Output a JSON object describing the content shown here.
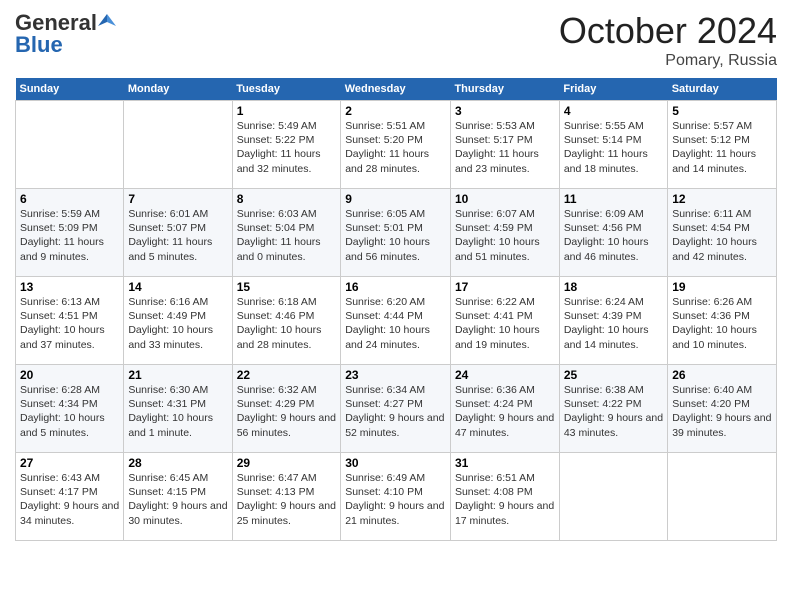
{
  "header": {
    "logo_general": "General",
    "logo_blue": "Blue",
    "month": "October 2024",
    "location": "Pomary, Russia"
  },
  "weekdays": [
    "Sunday",
    "Monday",
    "Tuesday",
    "Wednesday",
    "Thursday",
    "Friday",
    "Saturday"
  ],
  "weeks": [
    [
      {
        "day": "",
        "info": ""
      },
      {
        "day": "",
        "info": ""
      },
      {
        "day": "1",
        "info": "Sunrise: 5:49 AM\nSunset: 5:22 PM\nDaylight: 11 hours and 32 minutes."
      },
      {
        "day": "2",
        "info": "Sunrise: 5:51 AM\nSunset: 5:20 PM\nDaylight: 11 hours and 28 minutes."
      },
      {
        "day": "3",
        "info": "Sunrise: 5:53 AM\nSunset: 5:17 PM\nDaylight: 11 hours and 23 minutes."
      },
      {
        "day": "4",
        "info": "Sunrise: 5:55 AM\nSunset: 5:14 PM\nDaylight: 11 hours and 18 minutes."
      },
      {
        "day": "5",
        "info": "Sunrise: 5:57 AM\nSunset: 5:12 PM\nDaylight: 11 hours and 14 minutes."
      }
    ],
    [
      {
        "day": "6",
        "info": "Sunrise: 5:59 AM\nSunset: 5:09 PM\nDaylight: 11 hours and 9 minutes."
      },
      {
        "day": "7",
        "info": "Sunrise: 6:01 AM\nSunset: 5:07 PM\nDaylight: 11 hours and 5 minutes."
      },
      {
        "day": "8",
        "info": "Sunrise: 6:03 AM\nSunset: 5:04 PM\nDaylight: 11 hours and 0 minutes."
      },
      {
        "day": "9",
        "info": "Sunrise: 6:05 AM\nSunset: 5:01 PM\nDaylight: 10 hours and 56 minutes."
      },
      {
        "day": "10",
        "info": "Sunrise: 6:07 AM\nSunset: 4:59 PM\nDaylight: 10 hours and 51 minutes."
      },
      {
        "day": "11",
        "info": "Sunrise: 6:09 AM\nSunset: 4:56 PM\nDaylight: 10 hours and 46 minutes."
      },
      {
        "day": "12",
        "info": "Sunrise: 6:11 AM\nSunset: 4:54 PM\nDaylight: 10 hours and 42 minutes."
      }
    ],
    [
      {
        "day": "13",
        "info": "Sunrise: 6:13 AM\nSunset: 4:51 PM\nDaylight: 10 hours and 37 minutes."
      },
      {
        "day": "14",
        "info": "Sunrise: 6:16 AM\nSunset: 4:49 PM\nDaylight: 10 hours and 33 minutes."
      },
      {
        "day": "15",
        "info": "Sunrise: 6:18 AM\nSunset: 4:46 PM\nDaylight: 10 hours and 28 minutes."
      },
      {
        "day": "16",
        "info": "Sunrise: 6:20 AM\nSunset: 4:44 PM\nDaylight: 10 hours and 24 minutes."
      },
      {
        "day": "17",
        "info": "Sunrise: 6:22 AM\nSunset: 4:41 PM\nDaylight: 10 hours and 19 minutes."
      },
      {
        "day": "18",
        "info": "Sunrise: 6:24 AM\nSunset: 4:39 PM\nDaylight: 10 hours and 14 minutes."
      },
      {
        "day": "19",
        "info": "Sunrise: 6:26 AM\nSunset: 4:36 PM\nDaylight: 10 hours and 10 minutes."
      }
    ],
    [
      {
        "day": "20",
        "info": "Sunrise: 6:28 AM\nSunset: 4:34 PM\nDaylight: 10 hours and 5 minutes."
      },
      {
        "day": "21",
        "info": "Sunrise: 6:30 AM\nSunset: 4:31 PM\nDaylight: 10 hours and 1 minute."
      },
      {
        "day": "22",
        "info": "Sunrise: 6:32 AM\nSunset: 4:29 PM\nDaylight: 9 hours and 56 minutes."
      },
      {
        "day": "23",
        "info": "Sunrise: 6:34 AM\nSunset: 4:27 PM\nDaylight: 9 hours and 52 minutes."
      },
      {
        "day": "24",
        "info": "Sunrise: 6:36 AM\nSunset: 4:24 PM\nDaylight: 9 hours and 47 minutes."
      },
      {
        "day": "25",
        "info": "Sunrise: 6:38 AM\nSunset: 4:22 PM\nDaylight: 9 hours and 43 minutes."
      },
      {
        "day": "26",
        "info": "Sunrise: 6:40 AM\nSunset: 4:20 PM\nDaylight: 9 hours and 39 minutes."
      }
    ],
    [
      {
        "day": "27",
        "info": "Sunrise: 6:43 AM\nSunset: 4:17 PM\nDaylight: 9 hours and 34 minutes."
      },
      {
        "day": "28",
        "info": "Sunrise: 6:45 AM\nSunset: 4:15 PM\nDaylight: 9 hours and 30 minutes."
      },
      {
        "day": "29",
        "info": "Sunrise: 6:47 AM\nSunset: 4:13 PM\nDaylight: 9 hours and 25 minutes."
      },
      {
        "day": "30",
        "info": "Sunrise: 6:49 AM\nSunset: 4:10 PM\nDaylight: 9 hours and 21 minutes."
      },
      {
        "day": "31",
        "info": "Sunrise: 6:51 AM\nSunset: 4:08 PM\nDaylight: 9 hours and 17 minutes."
      },
      {
        "day": "",
        "info": ""
      },
      {
        "day": "",
        "info": ""
      }
    ]
  ]
}
